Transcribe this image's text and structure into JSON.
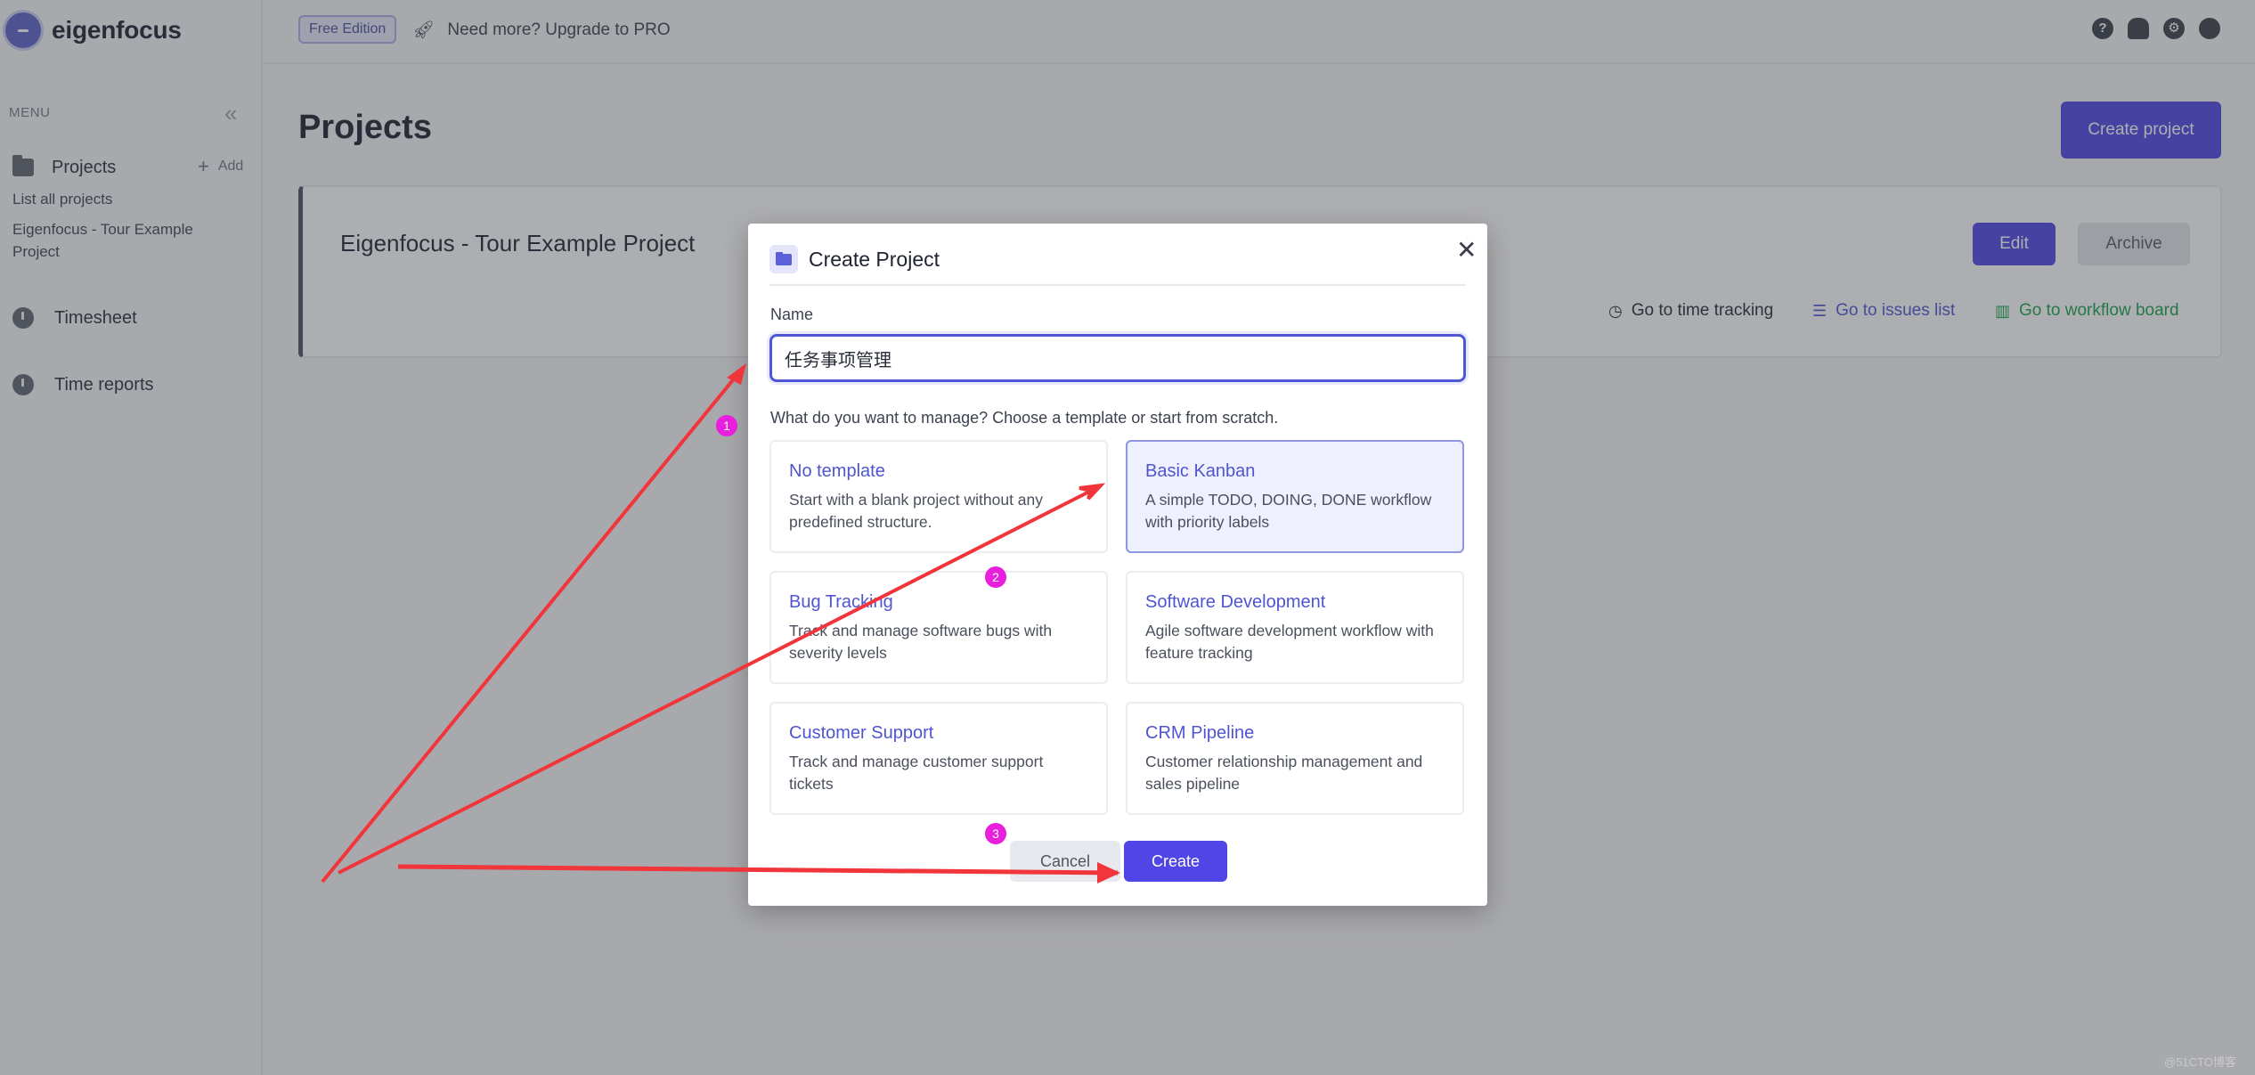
{
  "brand": {
    "name": "eigenfocus"
  },
  "sidebar": {
    "menu_label": "MENU",
    "projects_label": "Projects",
    "add_label": "Add",
    "links": [
      "List all projects",
      "Eigenfocus - Tour Example Project"
    ],
    "items": [
      {
        "label": "Timesheet"
      },
      {
        "label": "Time reports"
      }
    ]
  },
  "topbar": {
    "edition": "Free Edition",
    "upgrade": "Need more? Upgrade to PRO",
    "icons": [
      "help-icon",
      "bell-icon",
      "gear-icon",
      "palette-icon"
    ]
  },
  "main": {
    "title": "Projects",
    "create_button": "Create project",
    "project": {
      "name": "Eigenfocus - Tour Example Project",
      "edit": "Edit",
      "archive": "Archive",
      "links": {
        "time_tracking": "Go to time tracking",
        "issues_list": "Go to issues list",
        "workflow_board": "Go to workflow board"
      }
    }
  },
  "modal": {
    "title": "Create Project",
    "name_label": "Name",
    "name_value": "任务事项管理",
    "choose_text": "What do you want to manage? Choose a template or start from scratch.",
    "templates": [
      {
        "name": "No template",
        "description": "Start with a blank project without any predefined structure.",
        "selected": false
      },
      {
        "name": "Basic Kanban",
        "description": "A simple TODO, DOING, DONE workflow with priority labels",
        "selected": true
      },
      {
        "name": "Bug Tracking",
        "description": "Track and manage software bugs with severity levels",
        "selected": false
      },
      {
        "name": "Software Development",
        "description": "Agile software development workflow with feature tracking",
        "selected": false
      },
      {
        "name": "Customer Support",
        "description": "Track and manage customer support tickets",
        "selected": false
      },
      {
        "name": "CRM Pipeline",
        "description": "Customer relationship management and sales pipeline",
        "selected": false
      }
    ],
    "cancel": "Cancel",
    "create": "Create"
  },
  "annotations": {
    "steps": [
      "1",
      "2",
      "3"
    ],
    "arrow_color": "#f0353b",
    "badge_color": "#e81fdc"
  },
  "colors": {
    "accent": "#4f46e5",
    "link_purple": "#4f55d1",
    "link_green": "#16a34a"
  },
  "watermark": "@51CTO博客"
}
